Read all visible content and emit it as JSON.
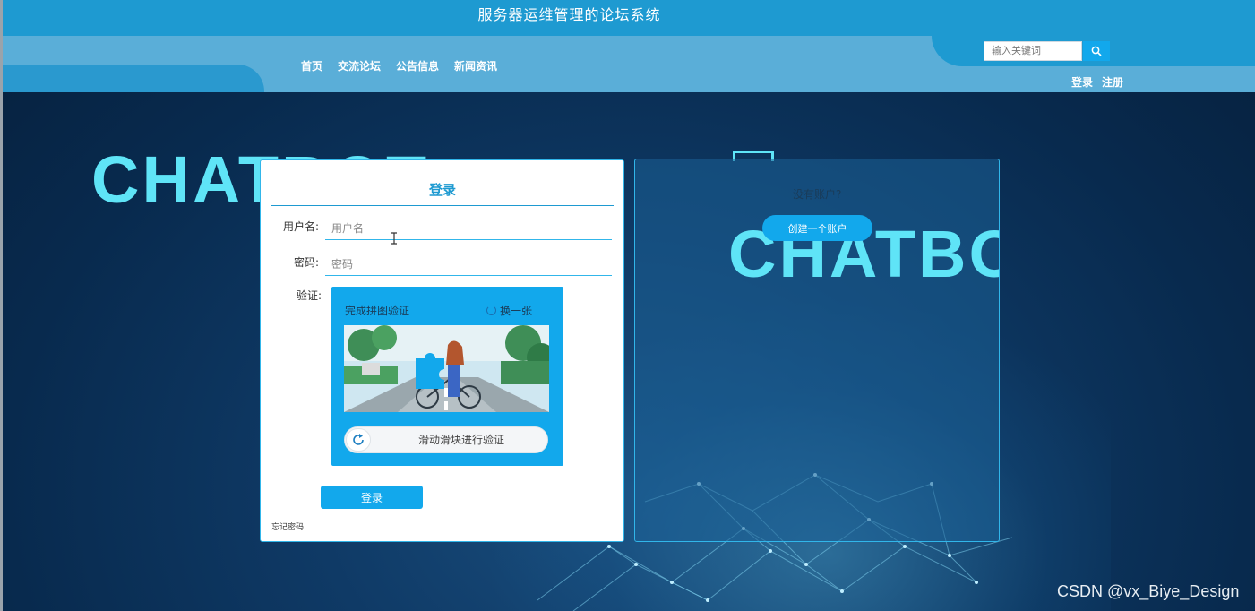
{
  "header": {
    "site_title": "服务器运维管理的论坛系统",
    "nav": [
      "首页",
      "交流论坛",
      "公告信息",
      "新闻资讯"
    ],
    "search_placeholder": "输入关键词",
    "login_link": "登录",
    "register_link": "注册"
  },
  "background": {
    "banner_text_1": "CHATBOT",
    "banner_text_2": "CHATBO"
  },
  "login": {
    "title": "登录",
    "username_label": "用户名:",
    "username_placeholder": "用户名",
    "password_label": "密码:",
    "password_placeholder": "密码",
    "verify_label": "验证:",
    "captcha_title": "完成拼图验证",
    "captcha_refresh": "换一张",
    "slider_text": "滑动滑块进行验证",
    "submit_label": "登录",
    "forgot_label": "忘记密码"
  },
  "register": {
    "question": "没有账户?",
    "button_label": "创建一个账户"
  },
  "watermark": "CSDN @vx_Biye_Design",
  "colors": {
    "primary": "#1e9ad1",
    "accent": "#12a8ec",
    "nav_bar": "#5aaed8",
    "banner_text": "#5fe4f7",
    "background": "#0f3a66"
  },
  "icons": {
    "search": "search-icon",
    "refresh": "refresh-icon",
    "slider": "slider-refresh-icon"
  }
}
